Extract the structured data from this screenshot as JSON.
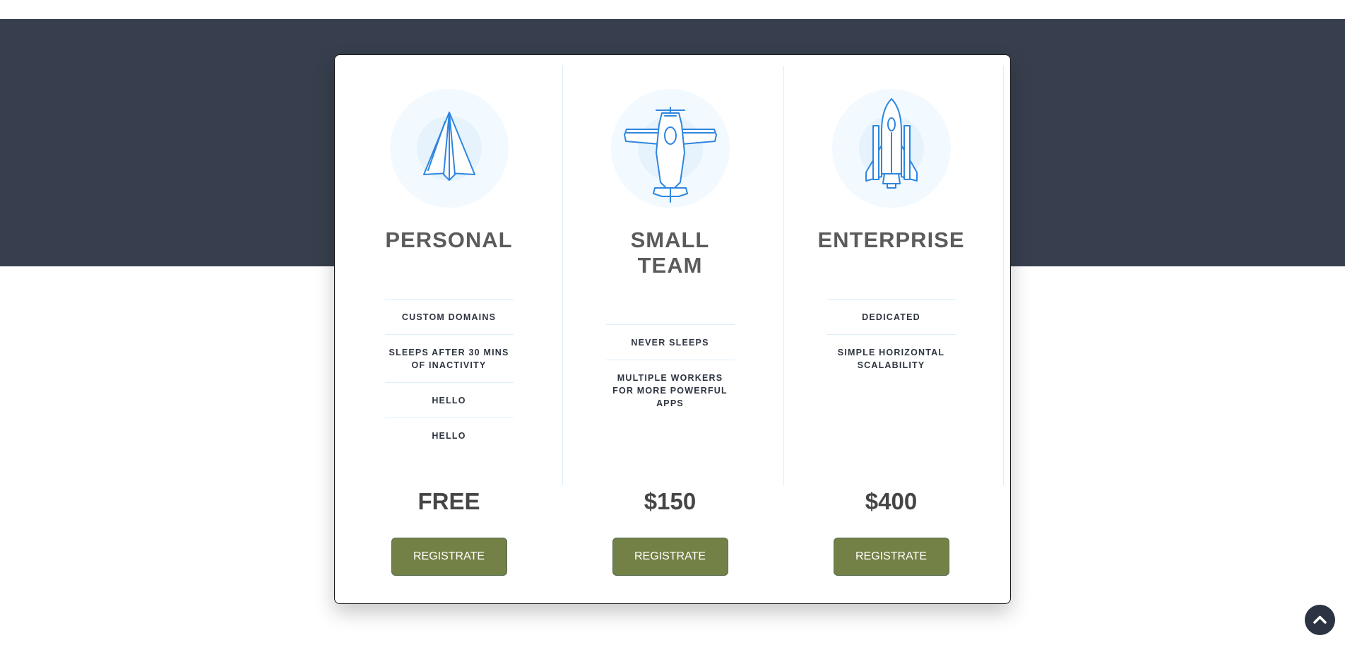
{
  "plans": [
    {
      "icon": "paper-plane-icon",
      "title": "PERSONAL",
      "features": [
        "CUSTOM DOMAINS",
        "SLEEPS AFTER 30 MINS OF INACTIVITY",
        "HELLO",
        "HELLO"
      ],
      "price": "FREE",
      "button_label": "REGISTRATE"
    },
    {
      "icon": "airplane-icon",
      "title": "SMALL TEAM",
      "features": [
        "NEVER SLEEPS",
        "MULTIPLE WORKERS FOR MORE POWERFUL APPS"
      ],
      "price": "$150",
      "button_label": "REGISTRATE"
    },
    {
      "icon": "space-shuttle-icon",
      "title": "ENTERPRISE",
      "features": [
        "DEDICATED",
        "SIMPLE HORIZONTAL SCALABILITY"
      ],
      "price": "$400",
      "button_label": "REGISTRATE"
    }
  ],
  "scroll_top_icon": "chevron-up-icon",
  "colors": {
    "band": "#373f4e",
    "button": "#748146",
    "icon_stroke": "#2f86e0",
    "title": "#5b5b5b"
  }
}
